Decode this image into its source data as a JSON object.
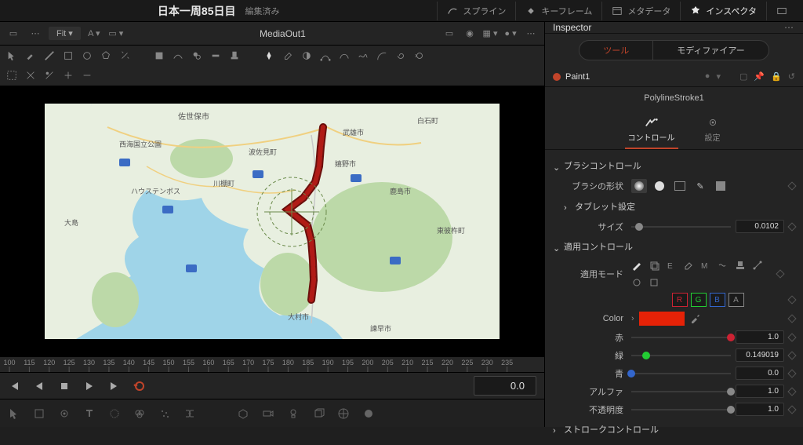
{
  "header": {
    "title": "日本一周85日目",
    "subtitle": "編集済み",
    "tabs": {
      "spline": "スプライン",
      "keyframe": "キーフレーム",
      "metadata": "メタデータ",
      "inspector": "インスペクタ"
    }
  },
  "viewer": {
    "fit_label": "Fit",
    "clip_name": "MediaOut1",
    "map_labels": {
      "sasebo": "佐世保市",
      "saikaikokuritsu": "西海国立公園",
      "huistenbosch": "ハウステンボス",
      "kawatana": "川棚町",
      "higashisonogi": "東彼杵町",
      "hasami": "波佐見町",
      "takeo": "武雄市",
      "shiroishi": "白石町",
      "ureshino": "嬉野市",
      "kashima": "鹿島市",
      "ojima": "大島",
      "omura": "大村市",
      "isahaya": "諫早市"
    },
    "red_path_color": "#b01b16"
  },
  "ruler": {
    "ticks": [
      100,
      115,
      120,
      125,
      130,
      135,
      140,
      145,
      150,
      155,
      160,
      165,
      170,
      175,
      180,
      185,
      190,
      195,
      200,
      205,
      210,
      215,
      220,
      225,
      230,
      235
    ]
  },
  "transport": {
    "timecode": "0.0"
  },
  "inspector": {
    "title": "Inspector",
    "tabs": {
      "tool": "ツール",
      "modifier": "モディファイアー"
    },
    "node": "Paint1",
    "stroke_name": "PolylineStroke1",
    "mode_tabs": {
      "controls": "コントロール",
      "settings": "設定"
    },
    "brush_section": "ブラシコントロール",
    "brush_shape_label": "ブラシの形状",
    "tablet_section": "タブレット設定",
    "size_label": "サイズ",
    "size_value": "0.0102",
    "apply_section": "適用コントロール",
    "apply_mode_label": "適用モード",
    "rgba": {
      "r": "R",
      "g": "G",
      "b": "B",
      "a": "A"
    },
    "color_label": "Color",
    "colors": {
      "red": {
        "label": "赤",
        "value": "1.0"
      },
      "green": {
        "label": "緑",
        "value": "0.149019"
      },
      "blue": {
        "label": "青",
        "value": "0.0"
      },
      "alpha": {
        "label": "アルファ",
        "value": "1.0"
      },
      "opacity": {
        "label": "不透明度",
        "value": "1.0"
      }
    },
    "swatch_color": "#e52207",
    "stroke_section": "ストロークコントロール"
  }
}
